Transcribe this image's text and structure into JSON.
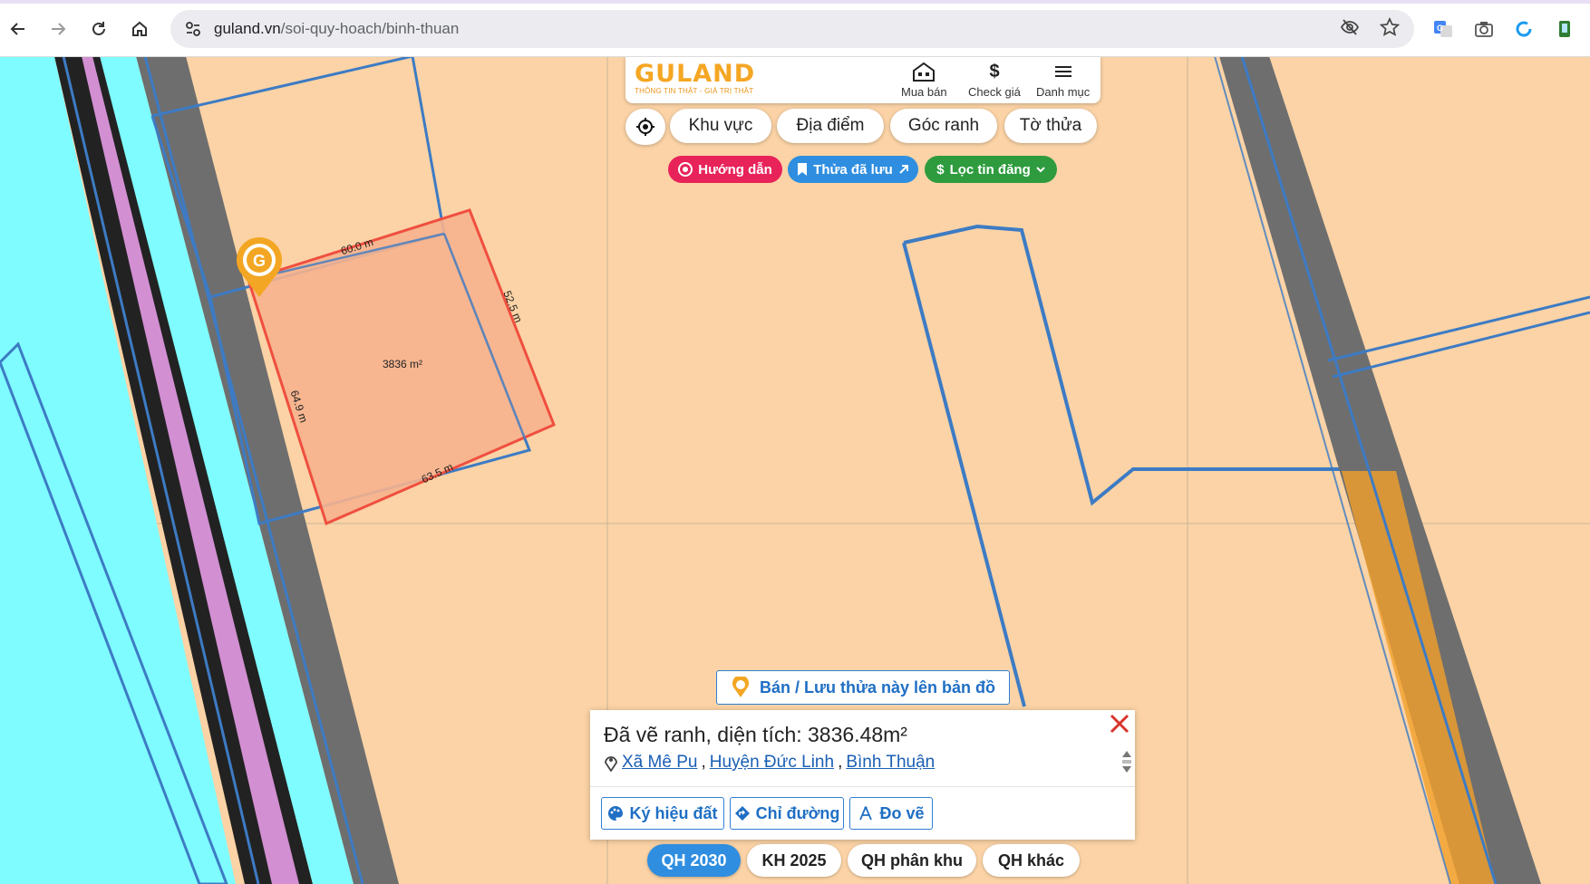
{
  "browser": {
    "url_host": "guland.vn",
    "url_path": "/soi-quy-hoach/binh-thuan"
  },
  "header": {
    "logo_text": "GULAND",
    "tagline": "THÔNG TIN THẬT - GIÁ TRỊ THẬT",
    "nav": [
      {
        "label": "Mua bán",
        "icon": "house-icon"
      },
      {
        "label": "Check giá",
        "icon": "dollar-icon"
      },
      {
        "label": "Danh mục",
        "icon": "menu-icon"
      }
    ]
  },
  "search_tabs": [
    "Khu vực",
    "Địa điểm",
    "Góc ranh",
    "Tờ thửa"
  ],
  "chips": {
    "guide": "Hướng dẫn",
    "saved": "Thửa đã lưu",
    "filter": "Lọc tin đăng"
  },
  "map": {
    "parcel_area_label": "3836 m²",
    "edge_labels": [
      "60.0 m",
      "52.5 m",
      "64.9 m",
      "63.5 m"
    ],
    "colors": {
      "land": "#fbd3a6",
      "river": "#7ffcff",
      "parcel_fill": "#f6b28e",
      "parcel_stroke": "#ef4f3f",
      "boundary": "#3d7bc4",
      "road": "#6e6e6e"
    }
  },
  "save_button": "Bán / Lưu thửa này lên bản đồ",
  "info_panel": {
    "title": "Đã vẽ ranh, diện tích: 3836.48m²",
    "location": [
      "Xã Mê Pu",
      "Huyện Đức Linh",
      "Bình Thuận"
    ],
    "actions": [
      "Ký hiệu đất",
      "Chỉ đường",
      "Đo vẽ"
    ]
  },
  "plan_tabs": [
    {
      "label": "QH 2030",
      "active": true
    },
    {
      "label": "KH 2025",
      "active": false
    },
    {
      "label": "QH phân khu",
      "active": false
    },
    {
      "label": "QH khác",
      "active": false
    }
  ]
}
